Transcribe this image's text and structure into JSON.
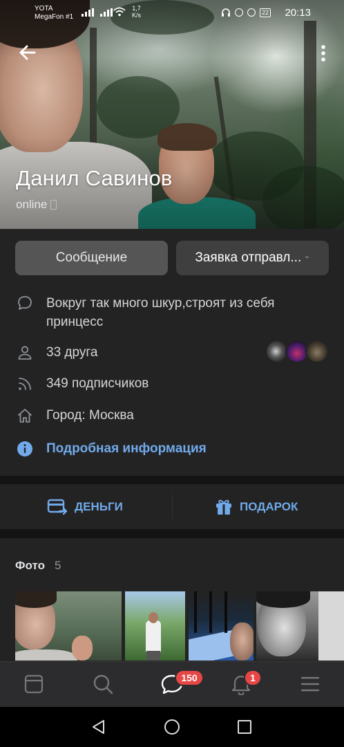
{
  "status_bar": {
    "carrier_1": "YOTA",
    "carrier_2": "MegaFon #1",
    "net_speed_value": "1,7",
    "net_speed_unit": "K/s",
    "battery": "22",
    "time": "20:13"
  },
  "profile": {
    "name": "Данил Савинов",
    "online_status": "online"
  },
  "buttons": {
    "message": "Сообщение",
    "request": "Заявка отправл..."
  },
  "info": {
    "status_text_line1": "Вокруг так много шкур,строят из себя",
    "status_text_line2": "принцесс",
    "friends": "33 друга",
    "subscribers": "349 подписчиков",
    "city": "Город: Москва",
    "more_info": "Подробная информация"
  },
  "actions": {
    "money": "ДЕНЬГИ",
    "gift": "ПОДАРОК"
  },
  "photos": {
    "title": "Фото",
    "count": "5"
  },
  "tabbar": {
    "messages_badge": "150",
    "notifications_badge": "1"
  },
  "colors": {
    "accent": "#71aaeb",
    "badge": "#e64646",
    "background": "#141414",
    "card": "#232323"
  }
}
